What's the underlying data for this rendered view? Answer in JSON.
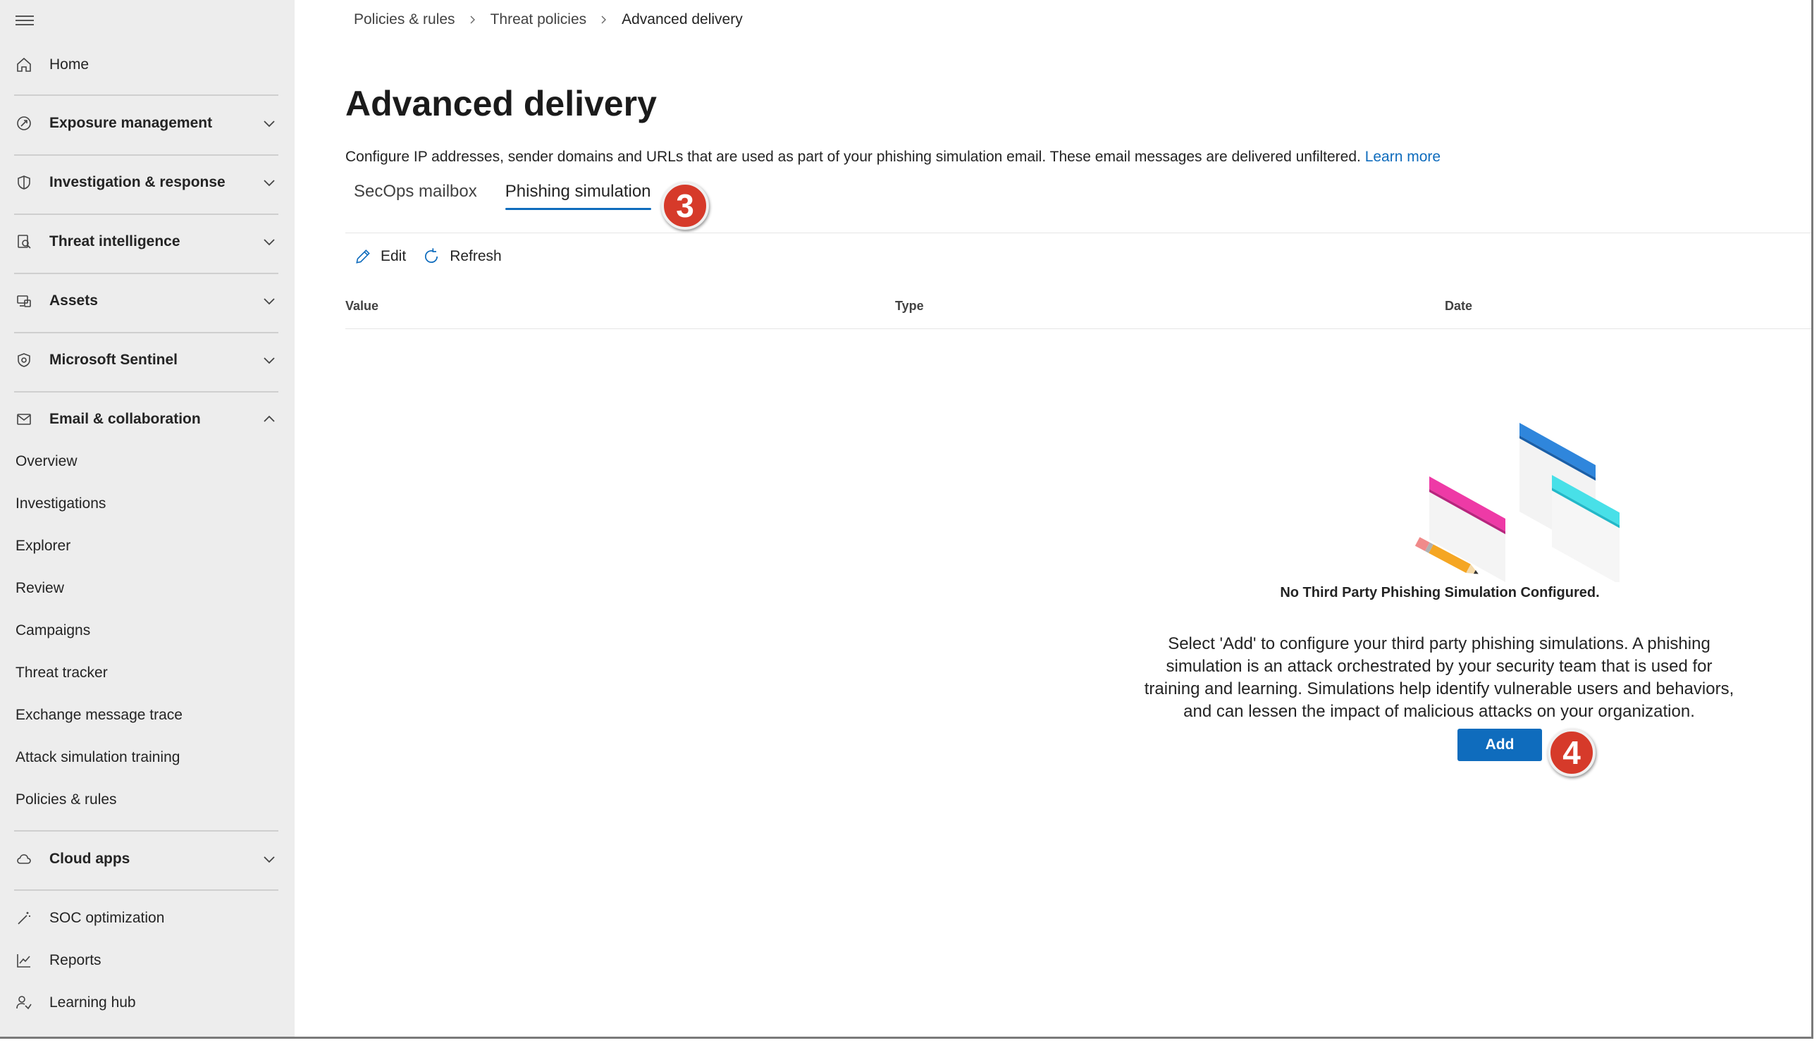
{
  "breadcrumb": [
    "Policies & rules",
    "Threat policies",
    "Advanced delivery"
  ],
  "page": {
    "title": "Advanced delivery",
    "description": "Configure IP addresses, sender domains and URLs that are used as part of your phishing simulation email. These email messages are delivered unfiltered.",
    "learn_more": "Learn more"
  },
  "tabs": [
    {
      "label": "SecOps mailbox",
      "active": false
    },
    {
      "label": "Phishing simulation",
      "active": true
    }
  ],
  "toolbar": {
    "edit": "Edit",
    "refresh": "Refresh"
  },
  "table": {
    "columns": [
      "Value",
      "Type",
      "Date"
    ]
  },
  "empty_state": {
    "title": "No Third Party Phishing Simulation Configured.",
    "text": "Select 'Add' to configure your third party phishing simulations. A phishing simulation is an attack orchestrated by your security team that is used for training and learning. Simulations help identify vulnerable users and behaviors, and can lessen the impact of malicious attacks on your organization.",
    "button": "Add"
  },
  "annotations": {
    "step_3": "3",
    "step_4": "4"
  },
  "sidebar": {
    "top": [
      {
        "label": "Home",
        "icon": "home-icon"
      }
    ],
    "groups": [
      {
        "label": "Exposure management",
        "icon": "exposure-icon",
        "expanded": false
      },
      {
        "label": "Investigation & response",
        "icon": "shield-icon",
        "expanded": false
      },
      {
        "label": "Threat intelligence",
        "icon": "threat-intel-icon",
        "expanded": false
      },
      {
        "label": "Assets",
        "icon": "assets-icon",
        "expanded": false
      },
      {
        "label": "Microsoft Sentinel",
        "icon": "sentinel-icon",
        "expanded": false
      },
      {
        "label": "Email & collaboration",
        "icon": "mail-icon",
        "expanded": true
      }
    ],
    "email_items": [
      "Overview",
      "Investigations",
      "Explorer",
      "Review",
      "Campaigns",
      "Threat tracker",
      "Exchange message trace",
      "Attack simulation training",
      "Policies & rules"
    ],
    "cloud_apps": {
      "label": "Cloud apps",
      "icon": "cloud-icon",
      "expanded": false
    },
    "bottom": [
      {
        "label": "SOC optimization",
        "icon": "wand-icon"
      },
      {
        "label": "Reports",
        "icon": "chart-icon"
      },
      {
        "label": "Learning hub",
        "icon": "learning-icon"
      }
    ]
  },
  "colors": {
    "accent": "#0f6cbd",
    "sidebar_bg": "#ededed",
    "badge": "#d63a2a"
  }
}
